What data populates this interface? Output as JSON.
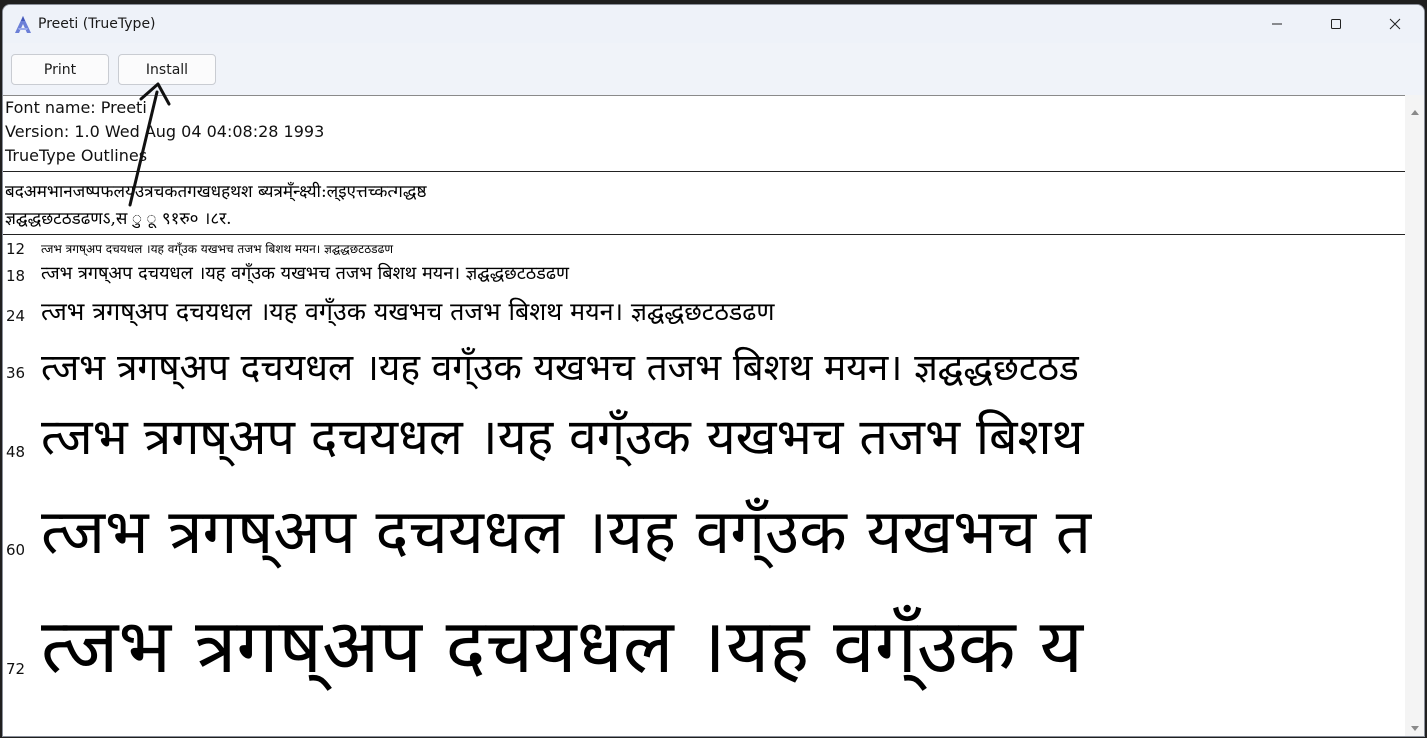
{
  "window": {
    "title": "Preeti (TrueType)",
    "icons": {
      "app": "font-viewer-icon",
      "minimize": "minimize-icon",
      "maximize": "maximize-icon",
      "close": "close-icon"
    }
  },
  "toolbar": {
    "print_label": "Print",
    "install_label": "Install"
  },
  "font_info": {
    "name_line": "Font name: Preeti",
    "version_line": "Version: 1.0 Wed Aug 04 04:08:28 1993",
    "outline_line": "TrueType Outlines"
  },
  "charset": {
    "line1": "बदअमभानजष्पफलयउत्रचकतगखधहथश ब्यत्रम्ँन्क्ष्यी:ल्इएत्तच्कत्गद्धष्ठ",
    "line2": "ज्ञद्घद्धछटठडढणऽ,स ु ू ९१रु० ।८र."
  },
  "samples": [
    {
      "size": "12",
      "text": "त्जभ त्रगष्अप दचयधल ।यह वग्ँउक यखभच तजभ बिशथ मयन। ज्ञद्घद्धछटठडढण"
    },
    {
      "size": "18",
      "text": "त्जभ त्रगष्अप दचयधल ।यह वग्ँउक यखभच तजभ बिशथ मयन। ज्ञद्घद्धछटठडढण"
    },
    {
      "size": "24",
      "text": "त्जभ त्रगष्अप दचयधल ।यह वग्ँउक यखभच तजभ बिशथ मयन। ज्ञद्घद्धछटठडढण"
    },
    {
      "size": "36",
      "text": "त्जभ त्रगष्अप दचयधल ।यह वग्ँउक यखभच तजभ बिशथ मयन। ज्ञद्घद्धछटठड"
    },
    {
      "size": "48",
      "text": "त्जभ त्रगष्अप दचयधल ।यह वग्ँउक यखभच तजभ बिशथ"
    },
    {
      "size": "60",
      "text": "त्जभ त्रगष्अप दचयधल ।यह वग्ँउक यखभच त"
    },
    {
      "size": "72",
      "text": "त्जभ त्रगष्अप दचयधल ।यह वग्ँउक य"
    }
  ]
}
